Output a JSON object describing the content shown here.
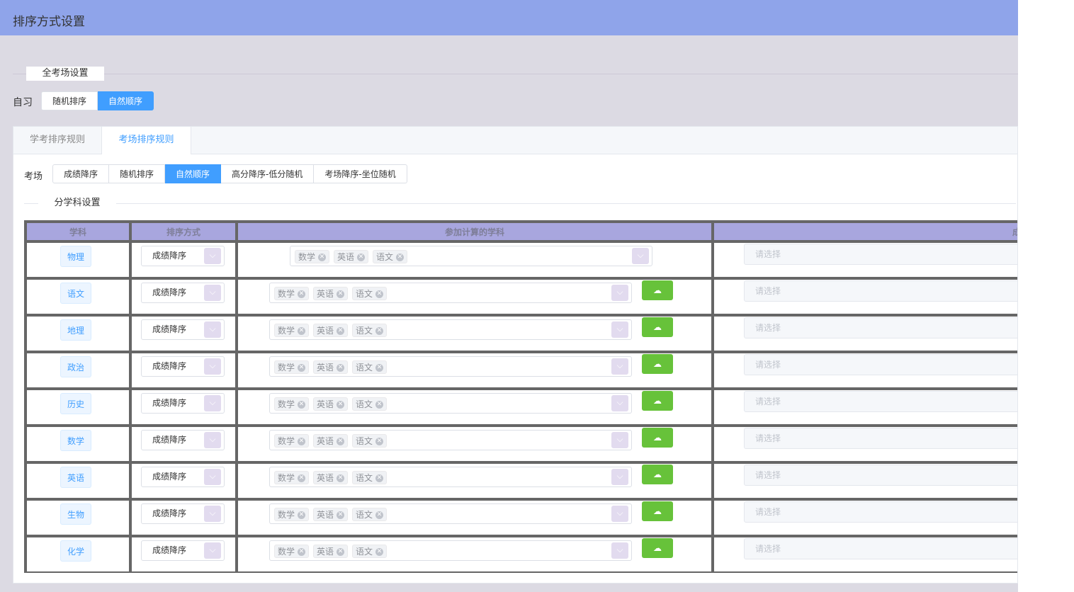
{
  "header": {
    "title": "排序方式设置"
  },
  "global": {
    "legend": "全考场设置",
    "zixi_label": "自习",
    "zixi_options": [
      "随机排序",
      "自然顺序"
    ],
    "zixi_active": "自然顺序"
  },
  "tabs": [
    "学考排序规则",
    "考场排序规则"
  ],
  "active_tab": "考场排序规则",
  "exam": {
    "label": "考场",
    "options": [
      "成绩降序",
      "随机排序",
      "自然顺序",
      "高分降序-低分随机",
      "考场降序-坐位随机"
    ],
    "active": "自然顺序"
  },
  "subject_settings": {
    "legend": "分学科设置",
    "columns": [
      "学科",
      "排序方式",
      "参加计算的学科",
      "成绩降序的考场"
    ],
    "rows": [
      {
        "subject": "物理",
        "sort": "成绩降序",
        "tags": [
          "数学",
          "英语",
          "语文"
        ],
        "placeholder": "请选择",
        "upload": false
      },
      {
        "subject": "语文",
        "sort": "成绩降序",
        "tags": [
          "数学",
          "英语",
          "语文"
        ],
        "placeholder": "请选择",
        "upload": true
      },
      {
        "subject": "地理",
        "sort": "成绩降序",
        "tags": [
          "数学",
          "英语",
          "语文"
        ],
        "placeholder": "请选择",
        "upload": true
      },
      {
        "subject": "政治",
        "sort": "成绩降序",
        "tags": [
          "数学",
          "英语",
          "语文"
        ],
        "placeholder": "请选择",
        "upload": true
      },
      {
        "subject": "历史",
        "sort": "成绩降序",
        "tags": [
          "数学",
          "英语",
          "语文"
        ],
        "placeholder": "请选择",
        "upload": true
      },
      {
        "subject": "数学",
        "sort": "成绩降序",
        "tags": [
          "数学",
          "英语",
          "语文"
        ],
        "placeholder": "请选择",
        "upload": true
      },
      {
        "subject": "英语",
        "sort": "成绩降序",
        "tags": [
          "数学",
          "英语",
          "语文"
        ],
        "placeholder": "请选择",
        "upload": true
      },
      {
        "subject": "生物",
        "sort": "成绩降序",
        "tags": [
          "数学",
          "英语",
          "语文"
        ],
        "placeholder": "请选择",
        "upload": true
      },
      {
        "subject": "化学",
        "sort": "成绩降序",
        "tags": [
          "数学",
          "英语",
          "语文"
        ],
        "placeholder": "请选择",
        "upload": true
      }
    ]
  },
  "icons": {
    "dropdown": "chevron-down-icon",
    "upload": "cloud-upload-icon",
    "tag_close": "close-circle-icon"
  },
  "colors": {
    "header": "#8fa4ea",
    "primary": "#409eff",
    "upload": "#67c23a",
    "table_header": "#a8a6de"
  }
}
